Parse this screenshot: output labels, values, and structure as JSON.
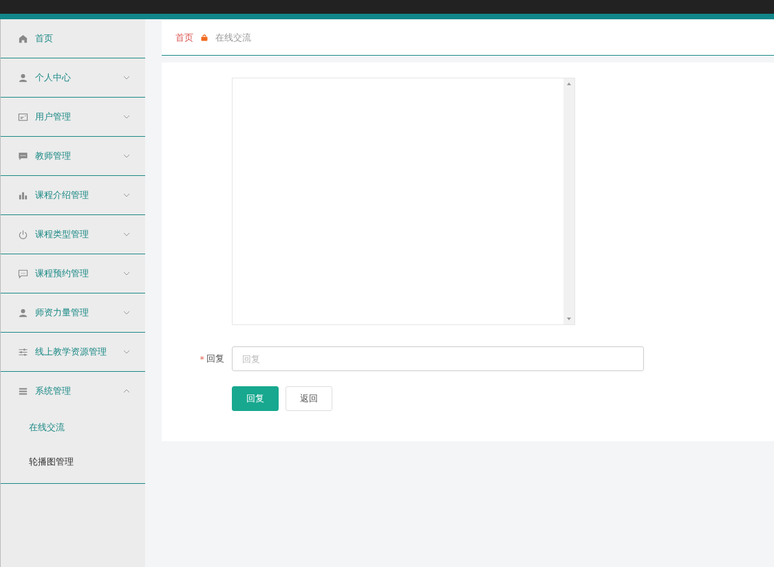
{
  "sidebar": {
    "items": [
      {
        "label": "首页",
        "kind": "link"
      },
      {
        "label": "个人中心",
        "kind": "menu",
        "expanded": false
      },
      {
        "label": "用户管理",
        "kind": "menu",
        "expanded": false
      },
      {
        "label": "教师管理",
        "kind": "menu",
        "expanded": false
      },
      {
        "label": "课程介绍管理",
        "kind": "menu",
        "expanded": false
      },
      {
        "label": "课程类型管理",
        "kind": "menu",
        "expanded": false
      },
      {
        "label": "课程预约管理",
        "kind": "menu",
        "expanded": false
      },
      {
        "label": "师资力量管理",
        "kind": "menu",
        "expanded": false
      },
      {
        "label": "线上教学资源管理",
        "kind": "menu",
        "expanded": false
      },
      {
        "label": "系统管理",
        "kind": "menu",
        "expanded": true,
        "children": [
          {
            "label": "在线交流",
            "selected": true
          },
          {
            "label": "轮播图管理",
            "selected": false
          }
        ]
      }
    ]
  },
  "breadcrumb": [
    {
      "label": "首页"
    },
    {
      "label": "在线交流"
    }
  ],
  "form": {
    "reply": {
      "label": "回复",
      "required_mark": "*",
      "placeholder": "回复"
    },
    "buttons": [
      {
        "label": "回复",
        "kind": "primary"
      },
      {
        "label": "返回",
        "kind": "default"
      }
    ]
  }
}
